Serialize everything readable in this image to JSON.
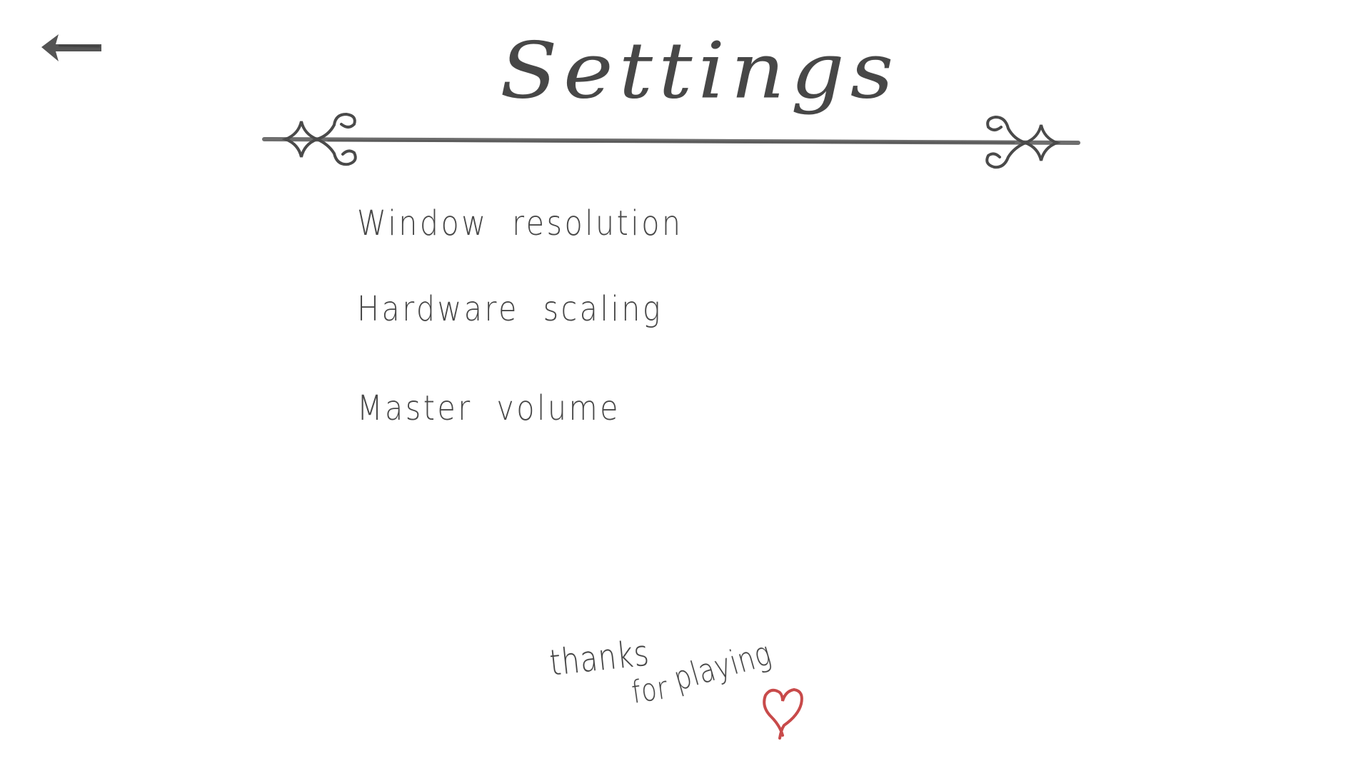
{
  "header": {
    "title": "Settings",
    "back_icon": "arrow-left-icon"
  },
  "menu": {
    "items": [
      {
        "label": "Window resolution"
      },
      {
        "label": "Hardware scaling"
      },
      {
        "label": "Master volume"
      }
    ]
  },
  "footer": {
    "thanks_words": [
      "thanks",
      "for",
      "playing"
    ],
    "heart_icon": "heart-icon"
  },
  "colors": {
    "pencil": "#454545",
    "heart": "#c84a4a",
    "background": "#ffffff"
  }
}
